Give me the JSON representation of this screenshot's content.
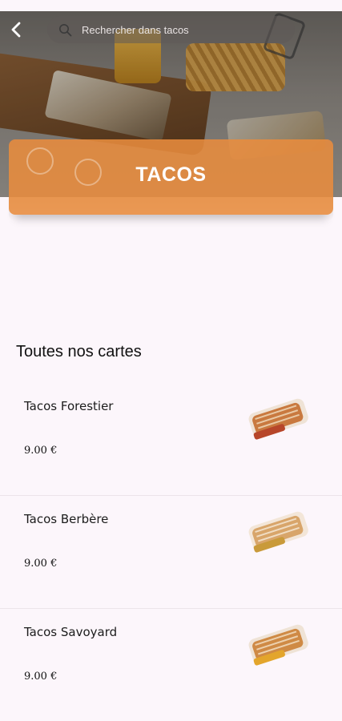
{
  "header": {
    "search_placeholder": "Rechercher dans tacos",
    "back_icon": "chevron-left-icon",
    "search_icon": "search-icon"
  },
  "banner": {
    "title": "TACOS",
    "color": "#e88c3e"
  },
  "menu": {
    "section_title": "Toutes nos cartes",
    "items": [
      {
        "name": "Tacos Forestier",
        "price": "9.00 €"
      },
      {
        "name": "Tacos Berbère",
        "price": "9.00 €"
      },
      {
        "name": "Tacos Savoyard",
        "price": "9.00 €"
      }
    ]
  },
  "colors": {
    "background": "#fcf6fb",
    "accent": "#e88c3e"
  }
}
